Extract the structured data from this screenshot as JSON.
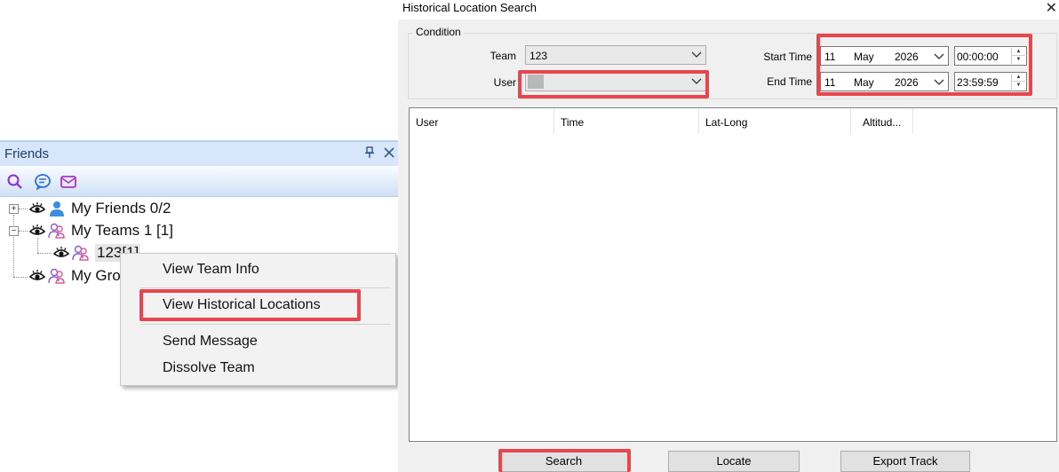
{
  "friends_panel": {
    "title": "Friends",
    "pin_icon": "pin-icon",
    "close_icon": "close-icon",
    "toolbar": [
      "search-icon",
      "chat-icon",
      "mail-icon"
    ],
    "tree": {
      "my_friends": "My Friends 0/2",
      "my_teams": "My Teams 1 [1]",
      "team_item": "123[1]",
      "my_groups": "My Gro"
    }
  },
  "context_menu": {
    "items": [
      "View Team Info",
      "View Historical Locations",
      "Send Message",
      "Dissolve Team"
    ]
  },
  "dialog": {
    "title": "Historical Location Search",
    "close_glyph": "✕",
    "condition_label": "Condition",
    "team_label": "Team",
    "team_value": "123",
    "user_label": "User",
    "user_value": "",
    "start_time_label": "Start Time",
    "end_time_label": "End Time",
    "start_date": {
      "day": "11",
      "month": "May",
      "year": "2026"
    },
    "end_date": {
      "day": "11",
      "month": "May",
      "year": "2026"
    },
    "start_clock": "00:00:00",
    "end_clock": "23:59:59",
    "columns": [
      "User",
      "Time",
      "Lat-Long",
      "Altitud..."
    ],
    "buttons": {
      "search": "Search",
      "locate": "Locate",
      "export": "Export Track"
    }
  },
  "colors": {
    "highlight": "#e8464c",
    "panel_header": "#d7e6fa",
    "dialog_bg": "#f0f0f0"
  }
}
